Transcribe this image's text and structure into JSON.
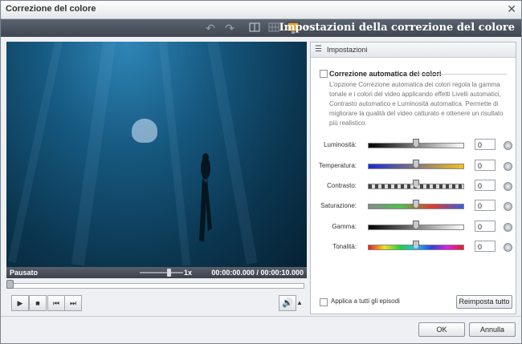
{
  "window": {
    "title": "Correzione del colore",
    "close_glyph": "✕"
  },
  "toolbar": {
    "heading": "Impostazioni della correzione del colore"
  },
  "player": {
    "status": "Pausato",
    "speed": "1x",
    "time_current": "00:00:00.000",
    "time_sep": "/",
    "time_total": "00:00:10.000",
    "speed_level_fraction": 0.6,
    "seek_fraction": 0.0
  },
  "panel": {
    "tab_label": "Impostazioni",
    "auto_label": "Correzione automatica dei colori",
    "auto_checked": false,
    "description": "L'opzione Correzione automatica dei colori regola la gamma tonale e i colori del video applicando effetti Livelli automatici, Contrasto automatico e Luminosità automatica. Permette di migliorare la qualità  del video catturato e ottenere un risultato più realistico.",
    "sliders": [
      {
        "label": "Luminosità:",
        "value": "0"
      },
      {
        "label": "Temperatura:",
        "value": "0"
      },
      {
        "label": "Contrasto:",
        "value": "0"
      },
      {
        "label": "Saturazione:",
        "value": "0"
      },
      {
        "label": "Gamma:",
        "value": "0"
      },
      {
        "label": "Tonalità:",
        "value": "0"
      }
    ],
    "apply_all_label": "Applica a tutti gli episodi",
    "reset_all_label": "Reimposta tutto"
  },
  "footer": {
    "ok_label": "OK",
    "cancel_label": "Annulla"
  },
  "icons": [
    "undo-icon",
    "redo-icon",
    "split-view-icon",
    "grid-view-icon",
    "monitor-icon",
    "settings-icon",
    "play-icon",
    "stop-icon",
    "prev-icon",
    "next-icon",
    "volume-icon",
    "reset-icon"
  ]
}
